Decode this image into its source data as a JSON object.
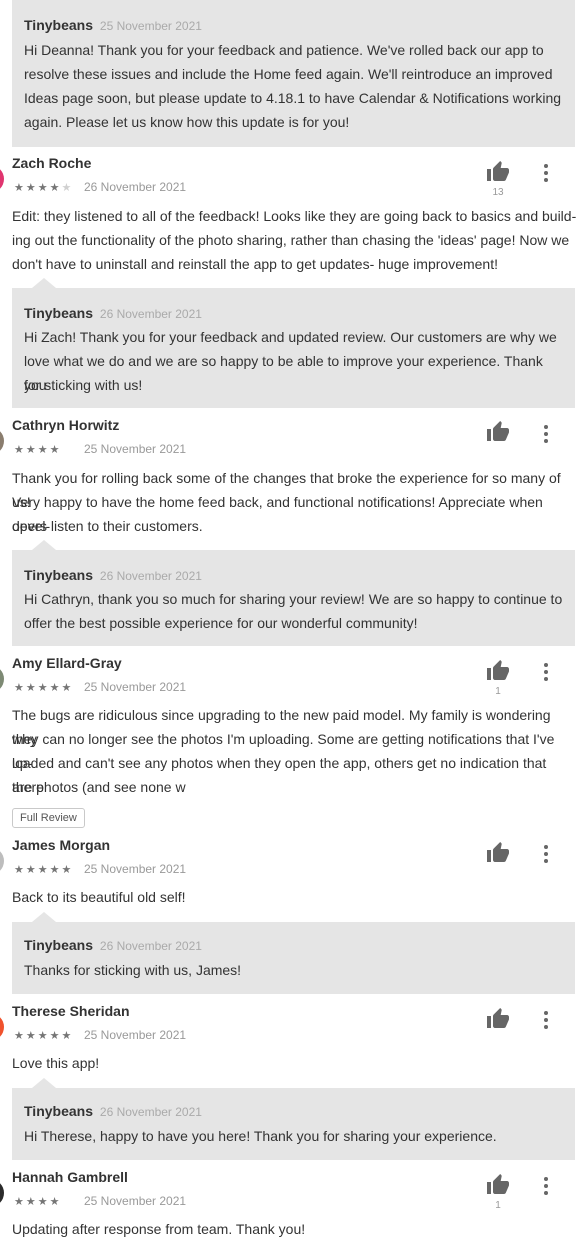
{
  "reviews": [
    {
      "reply": {
        "dev": "Tinybeans",
        "date": "25 November 2021",
        "lines": [
          "Hi Deanna! Thank you for your feedback and patience. We've rolled back our app to",
          "resolve these issues and include the Home feed again. We'll reintroduce an improved",
          "Ideas page soon, but please update to 4.18.1 to have Calendar & Notifications working",
          "again. Please let us know how this update is for you!"
        ]
      }
    },
    {
      "author": "Zach Roche",
      "stars_on": "★★★★",
      "stars_off": "★",
      "date": "26 November 2021",
      "likes": "13",
      "lines": [
        "Edit: they listened to all of the feedback! Looks like they are going back to basics and build-",
        "ing out the functionality of the photo sharing, rather than chasing the 'ideas' page! Now we",
        "don't have to uninstall and reinstall the app to get updates- huge improvement!"
      ],
      "reply": {
        "dev": "Tinybeans",
        "date": "26 November 2021",
        "lines": [
          "Hi Zach! Thank you for your feedback and updated review. Our customers are why we",
          "love what we do and we are so happy to be able to improve your experience. Thank you",
          "for sticking with us!"
        ]
      }
    },
    {
      "author": "Cathryn Horwitz",
      "stars_on": "★★★★",
      "stars_off": "",
      "date": "25 November 2021",
      "likes": "",
      "lines": [
        "Thank you for rolling back some of the changes that broke the experience for so many of us!",
        "Very happy to have the home feed back, and functional notifications! Appreciate when devel-",
        "opers listen to their customers."
      ],
      "reply": {
        "dev": "Tinybeans",
        "date": "26 November 2021",
        "lines": [
          "Hi Cathryn, thank you so much for sharing your review! We are so happy to continue to",
          "offer the best possible experience for our wonderful community!"
        ]
      }
    },
    {
      "author": "Amy Ellard-Gray",
      "stars_on": "★★★★★",
      "stars_off": "",
      "date": "25 November 2021",
      "likes": "1",
      "lines": [
        "The bugs are ridiculous since upgrading to the new paid model. My family is wondering why",
        "they can no longer see the photos I'm uploading. Some are getting notifications that I've up-",
        "loaded and can't see any photos when they open the app, others get no indication that there",
        "are photos (and see none w"
      ],
      "full_review_label": "Full Review"
    },
    {
      "author": "James Morgan",
      "stars_on": "★★★★★",
      "stars_off": "",
      "date": "25 November 2021",
      "likes": "",
      "lines": [
        "Back to its beautiful old self!"
      ],
      "reply": {
        "dev": "Tinybeans",
        "date": "26 November 2021",
        "lines": [
          "Thanks for sticking with us, James!"
        ]
      }
    },
    {
      "author": "Therese Sheridan",
      "stars_on": "★★★★★",
      "stars_off": "",
      "date": "25 November 2021",
      "likes": "",
      "lines": [
        "Love this app!"
      ],
      "reply": {
        "dev": "Tinybeans",
        "date": "26 November 2021",
        "lines": [
          "Hi Therese, happy to have you here! Thank you for sharing your experience."
        ]
      }
    },
    {
      "author": "Hannah Gambrell",
      "stars_on": "★★★★",
      "stars_off": "",
      "date": "25 November 2021",
      "likes": "1",
      "lines": [
        "Updating after response from team. Thank you!"
      ]
    }
  ],
  "icons": {
    "like": "thumbs-up-icon",
    "menu": "more-vert-icon"
  },
  "colors": {
    "reply_background": "#e5e5e5",
    "text": "#333333",
    "muted": "#999999"
  }
}
